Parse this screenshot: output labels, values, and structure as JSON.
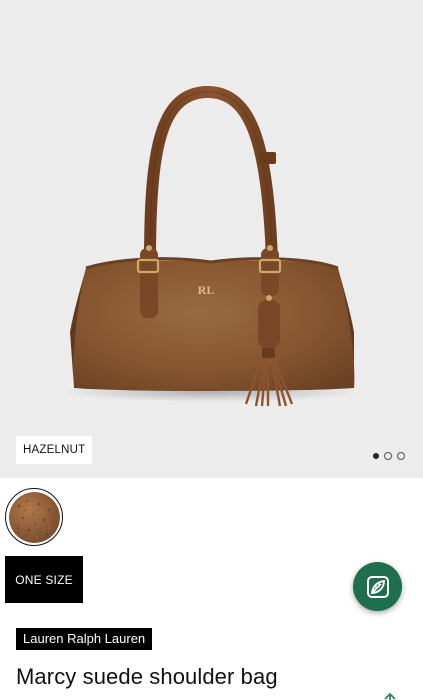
{
  "product": {
    "color_label": "HAZELNUT",
    "size_label": "ONE SIZE",
    "brand": "Lauren Ralph Lauren",
    "title": "Marcy suede shoulder bag",
    "image_count": 3,
    "active_image": 1
  },
  "colors": {
    "hero_bg": "#ececec",
    "suede": "#8a5a33",
    "strap": "#7a4826",
    "fab_green": "#1f6e4e"
  },
  "icons": {
    "fab": "leaf-icon",
    "scroll": "up-arrow-icon"
  }
}
